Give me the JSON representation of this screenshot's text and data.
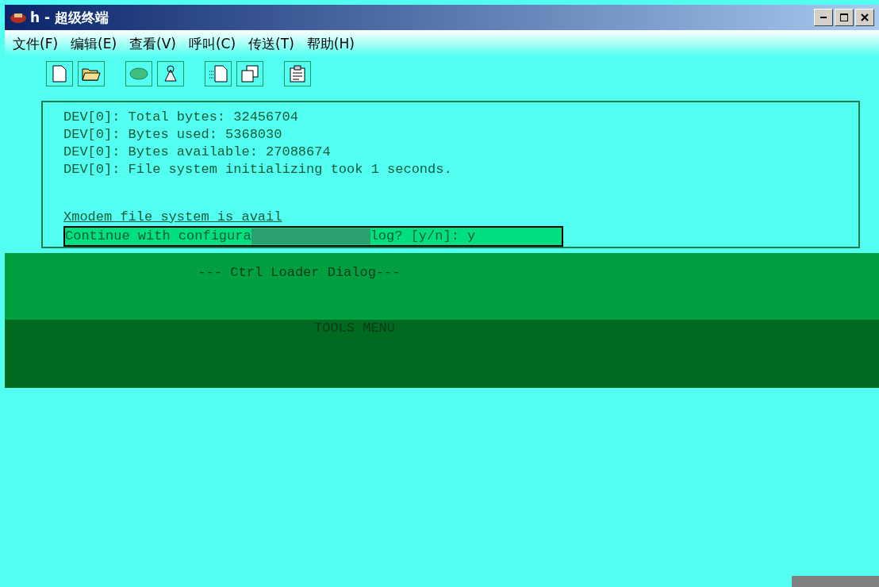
{
  "window": {
    "title": "h - 超级终端"
  },
  "menu": [
    "文件(F)",
    "编辑(E)",
    "查看(V)",
    "呼叫(C)",
    "传送(T)",
    "帮助(H)"
  ],
  "terminal": {
    "lines": [
      "DEV[0]: Total bytes: 32456704",
      "DEV[0]: Bytes used: 5368030",
      "DEV[0]: Bytes available: 27088674",
      "DEV[0]: File system initializing took 1 seconds."
    ],
    "status_line": "Xmodem file system is avail",
    "prompt": {
      "start": "Continue with configura",
      "end": "log? [y/n]: y"
    }
  },
  "dialog": {
    "heading": "--- Ctrl Loader Dialog---",
    "menu_title": "TOOLS MENU"
  }
}
